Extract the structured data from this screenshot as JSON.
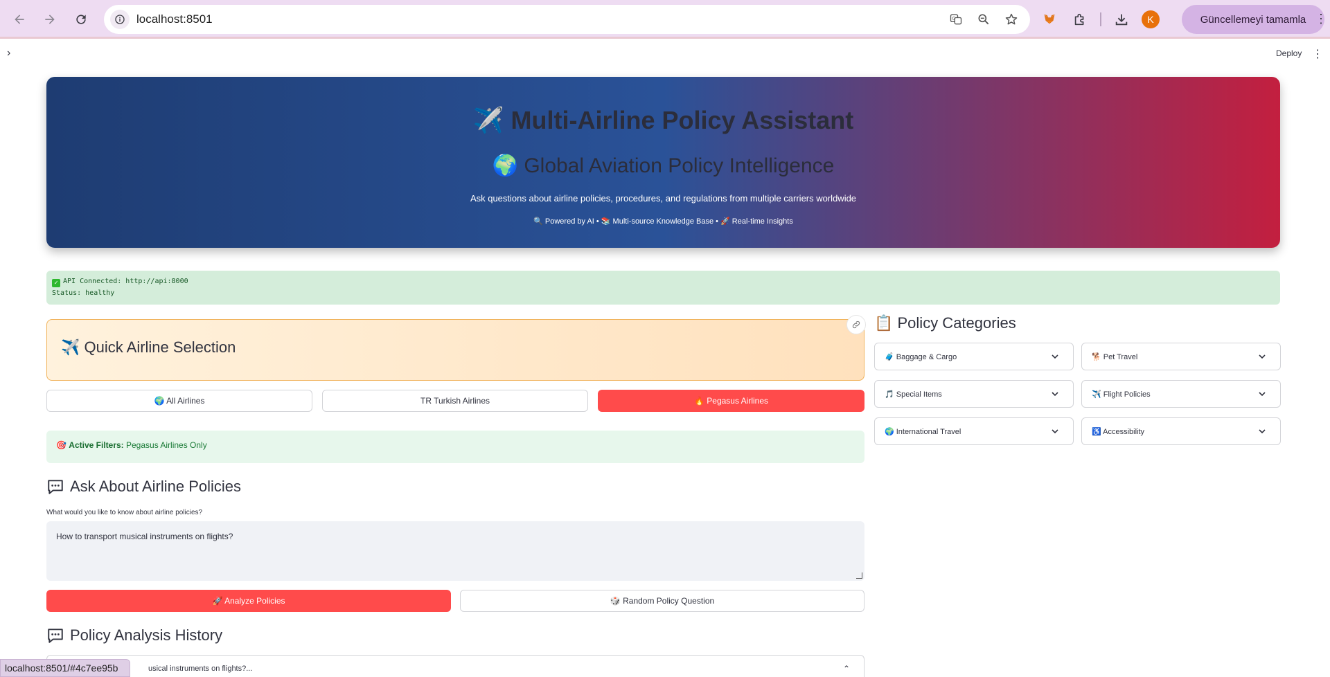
{
  "browser": {
    "url": "localhost:8501",
    "update_button": "Güncellemeyi tamamla",
    "profile_initial": "K",
    "status_url": "localhost:8501/#4c7ee95b"
  },
  "toolbar": {
    "sidebar_toggle": "›",
    "deploy": "Deploy",
    "menu": "⋮"
  },
  "hero": {
    "title": "✈️ Multi-Airline Policy Assistant",
    "subtitle": "🌍 Global Aviation Policy Intelligence",
    "description": "Ask questions about airline policies, procedures, and regulations from multiple carriers worldwide",
    "tags": "🔍 Powered by AI • 📚 Multi-source Knowledge Base • 🚀 Real-time Insights"
  },
  "api_status": {
    "line1": "API Connected: http://api:8000",
    "line2": "Status: healthy"
  },
  "quick_selection": {
    "title": "✈️ Quick Airline Selection",
    "buttons": [
      {
        "label": "🌍 All Airlines"
      },
      {
        "label": "TR Turkish Airlines"
      },
      {
        "label": "🔥 Pegasus Airlines"
      }
    ],
    "active_filters_label": "Active Filters:",
    "active_filters_value": "Pegasus Airlines Only",
    "filter_icon": "🎯"
  },
  "ask": {
    "title": "Ask About Airline Policies",
    "question_label": "What would you like to know about airline policies?",
    "question_value": "How to transport musical instruments on flights?",
    "analyze_button": "🚀 Analyze Policies",
    "random_button": "🎲 Random Policy Question"
  },
  "history": {
    "title": "Policy Analysis History",
    "item_text": "usical instruments on flights?..."
  },
  "categories": {
    "title": "📋 Policy Categories",
    "items": [
      {
        "label": "🧳 Baggage & Cargo"
      },
      {
        "label": "🐕 Pet Travel"
      },
      {
        "label": "🎵 Special Items"
      },
      {
        "label": "✈️ Flight Policies"
      },
      {
        "label": "🌍 International Travel"
      },
      {
        "label": "♿ Accessibility"
      }
    ]
  }
}
